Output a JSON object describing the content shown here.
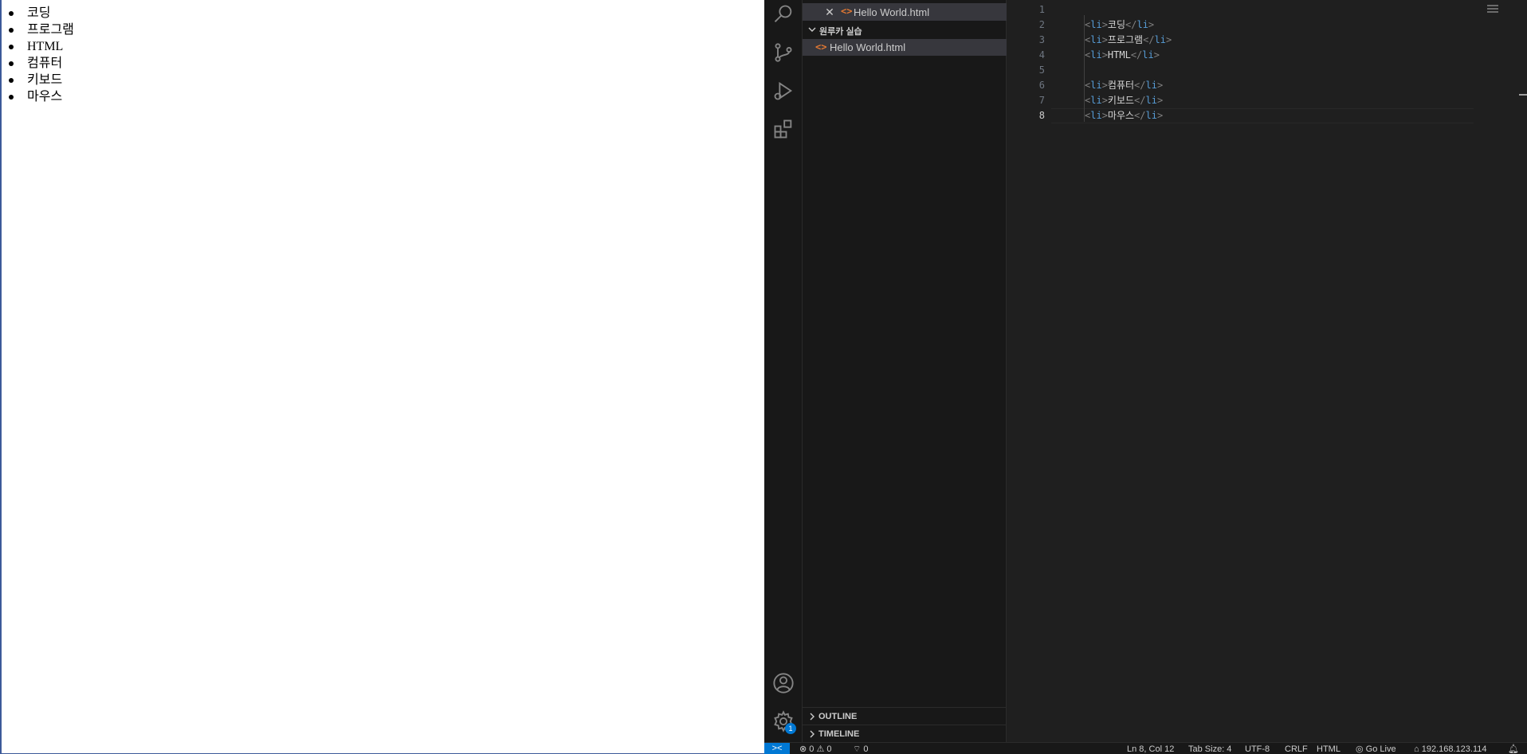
{
  "preview": {
    "items": [
      "코딩",
      "프로그램",
      "HTML",
      "컴퓨터",
      "키보드",
      "마우스"
    ]
  },
  "activity_bar": {
    "icons": [
      "search-icon",
      "source-control-icon",
      "run-debug-icon",
      "extensions-icon",
      "account-icon",
      "manage-gear-icon"
    ],
    "manage_badge": "1"
  },
  "sidebar": {
    "open_editor": {
      "close_glyph": "✕",
      "file_icon": "<>",
      "filename": "Hello World.html"
    },
    "folder": {
      "name": "원루카 실습"
    },
    "files": [
      {
        "icon": "<>",
        "name": "Hello World.html"
      }
    ],
    "outline_label": "OUTLINE",
    "timeline_label": "TIMELINE"
  },
  "editor": {
    "line_numbers": [
      "1",
      "2",
      "3",
      "4",
      "5",
      "6",
      "7",
      "8"
    ],
    "active_line": "8",
    "lines": [
      {
        "text": ""
      },
      {
        "text": "코딩"
      },
      {
        "text": "프로그램"
      },
      {
        "text": "HTML"
      },
      {
        "text": ""
      },
      {
        "text": "컴퓨터"
      },
      {
        "text": "키보드"
      },
      {
        "text": "마우스"
      }
    ],
    "tag_open": "<li>",
    "tag_close": "</li>"
  },
  "status_bar": {
    "remote_glyph": "><",
    "errors": "0",
    "warnings": "0",
    "ports": "0",
    "position": "Ln 8, Col 12",
    "tab_size": "Tab Size: 4",
    "encoding": "UTF-8",
    "eol": "CRLF",
    "language": "HTML",
    "go_live": "Go Live",
    "server": "192.168.123.114"
  },
  "colors": {
    "accent": "#0078d4",
    "html_icon": "#e37933",
    "tag_name": "#569cd6"
  }
}
